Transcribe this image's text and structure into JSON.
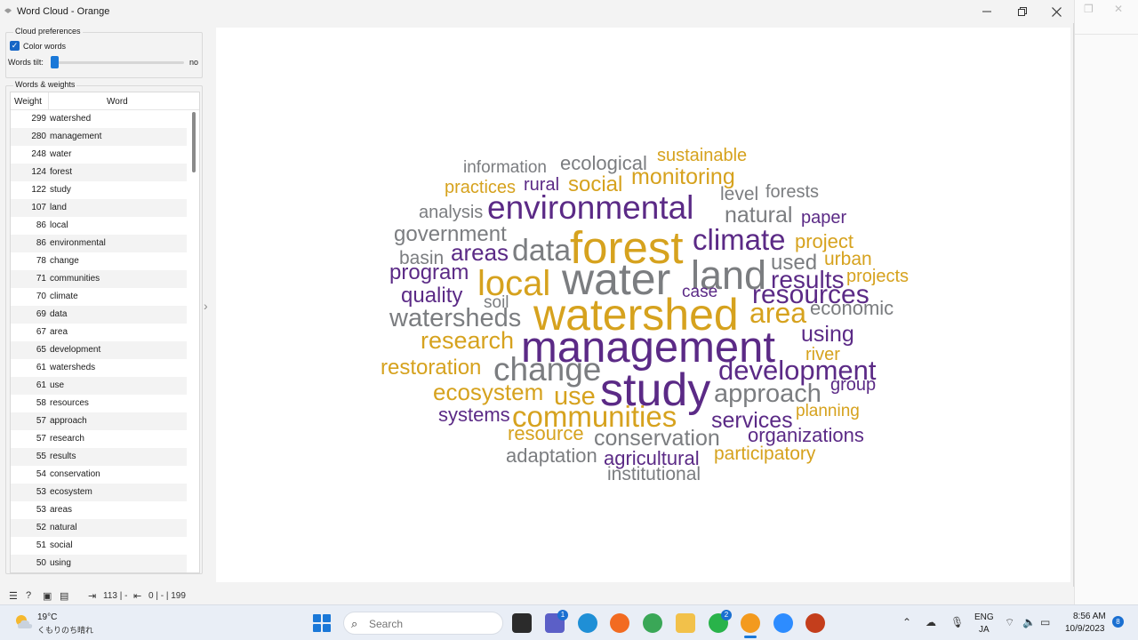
{
  "window": {
    "title": "Word Cloud - Orange"
  },
  "cloud_preferences": {
    "group_title": "Cloud preferences",
    "color_words_label": "Color words",
    "color_words_checked": true,
    "tilt_label": "Words tilt:",
    "tilt_value": "no",
    "tilt_level": 0
  },
  "words_weights": {
    "group_title": "Words & weights",
    "columns": [
      "Weight",
      "Word"
    ],
    "rows": [
      {
        "weight": "299",
        "word": "watershed"
      },
      {
        "weight": "280",
        "word": "management"
      },
      {
        "weight": "248",
        "word": "water"
      },
      {
        "weight": "124",
        "word": "forest"
      },
      {
        "weight": "122",
        "word": "study"
      },
      {
        "weight": "107",
        "word": "land"
      },
      {
        "weight": "86",
        "word": "local"
      },
      {
        "weight": "86",
        "word": "environmental"
      },
      {
        "weight": "78",
        "word": "change"
      },
      {
        "weight": "71",
        "word": "communities"
      },
      {
        "weight": "70",
        "word": "climate"
      },
      {
        "weight": "69",
        "word": "data"
      },
      {
        "weight": "67",
        "word": "area"
      },
      {
        "weight": "65",
        "word": "development"
      },
      {
        "weight": "61",
        "word": "watersheds"
      },
      {
        "weight": "61",
        "word": "use"
      },
      {
        "weight": "58",
        "word": "resources"
      },
      {
        "weight": "57",
        "word": "approach"
      },
      {
        "weight": "57",
        "word": "research"
      },
      {
        "weight": "55",
        "word": "results"
      },
      {
        "weight": "54",
        "word": "conservation"
      },
      {
        "weight": "53",
        "word": "ecosystem"
      },
      {
        "weight": "53",
        "word": "areas"
      },
      {
        "weight": "52",
        "word": "natural"
      },
      {
        "weight": "51",
        "word": "social"
      },
      {
        "weight": "50",
        "word": "using"
      }
    ]
  },
  "colors": {
    "purple": "#5b2a86",
    "gold": "#d6a21e",
    "gray": "#7b7d80"
  },
  "cloud_words": [
    {
      "text": "information",
      "color": "gray"
    },
    {
      "text": "ecological",
      "color": "gray"
    },
    {
      "text": "sustainable",
      "color": "gold"
    },
    {
      "text": "practices",
      "color": "gold"
    },
    {
      "text": "rural",
      "color": "purple"
    },
    {
      "text": "social",
      "color": "gold"
    },
    {
      "text": "monitoring",
      "color": "gold"
    },
    {
      "text": "level",
      "color": "gray"
    },
    {
      "text": "forests",
      "color": "gray"
    },
    {
      "text": "analysis",
      "color": "gray"
    },
    {
      "text": "environmental",
      "color": "purple"
    },
    {
      "text": "natural",
      "color": "gray"
    },
    {
      "text": "paper",
      "color": "purple"
    },
    {
      "text": "government",
      "color": "gray"
    },
    {
      "text": "forest",
      "color": "gold"
    },
    {
      "text": "climate",
      "color": "purple"
    },
    {
      "text": "project",
      "color": "gold"
    },
    {
      "text": "basin",
      "color": "gray"
    },
    {
      "text": "areas",
      "color": "purple"
    },
    {
      "text": "data",
      "color": "gray"
    },
    {
      "text": "used",
      "color": "gray"
    },
    {
      "text": "urban",
      "color": "gold"
    },
    {
      "text": "program",
      "color": "purple"
    },
    {
      "text": "water",
      "color": "gray"
    },
    {
      "text": "land",
      "color": "gray"
    },
    {
      "text": "results",
      "color": "purple"
    },
    {
      "text": "projects",
      "color": "gold"
    },
    {
      "text": "quality",
      "color": "purple"
    },
    {
      "text": "local",
      "color": "gold"
    },
    {
      "text": "case",
      "color": "purple"
    },
    {
      "text": "resources",
      "color": "purple"
    },
    {
      "text": "soil",
      "color": "gray"
    },
    {
      "text": "economic",
      "color": "gray"
    },
    {
      "text": "watersheds",
      "color": "gray"
    },
    {
      "text": "watershed",
      "color": "gold"
    },
    {
      "text": "area",
      "color": "gold"
    },
    {
      "text": "using",
      "color": "purple"
    },
    {
      "text": "research",
      "color": "gold"
    },
    {
      "text": "management",
      "color": "purple"
    },
    {
      "text": "river",
      "color": "gold"
    },
    {
      "text": "restoration",
      "color": "gold"
    },
    {
      "text": "change",
      "color": "gray"
    },
    {
      "text": "development",
      "color": "purple"
    },
    {
      "text": "group",
      "color": "purple"
    },
    {
      "text": "ecosystem",
      "color": "gold"
    },
    {
      "text": "use",
      "color": "gold"
    },
    {
      "text": "study",
      "color": "purple"
    },
    {
      "text": "approach",
      "color": "gray"
    },
    {
      "text": "planning",
      "color": "gold"
    },
    {
      "text": "systems",
      "color": "purple"
    },
    {
      "text": "communities",
      "color": "gold"
    },
    {
      "text": "services",
      "color": "purple"
    },
    {
      "text": "resource",
      "color": "gold"
    },
    {
      "text": "conservation",
      "color": "gray"
    },
    {
      "text": "organizations",
      "color": "purple"
    },
    {
      "text": "adaptation",
      "color": "gray"
    },
    {
      "text": "agricultural",
      "color": "purple"
    },
    {
      "text": "participatory",
      "color": "gold"
    },
    {
      "text": "institutional",
      "color": "gray"
    }
  ],
  "statusbar": {
    "input_summary": "113 | -",
    "output_summary": "0 | - | 199"
  },
  "taskbar": {
    "weather_temp": "19°C",
    "weather_desc": "くもりのち晴れ",
    "search_placeholder": "Search",
    "teams_badge": "1",
    "whatsapp_badge": "2",
    "lang_primary": "ENG",
    "lang_secondary": "JA",
    "time": "8:56 AM",
    "date": "10/9/2023",
    "notification_count": "8"
  }
}
